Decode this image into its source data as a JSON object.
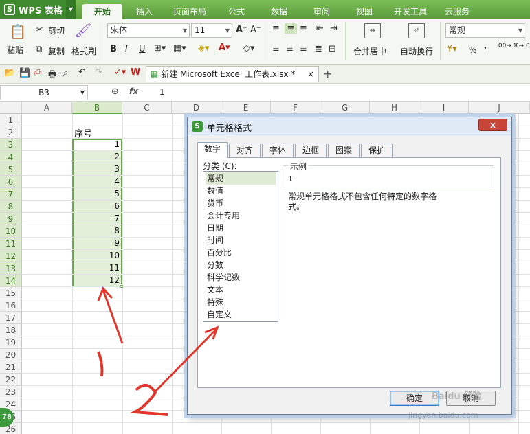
{
  "app": {
    "name": "WPS 表格",
    "logo": "S"
  },
  "tabs": [
    "开始",
    "插入",
    "页面布局",
    "公式",
    "数据",
    "审阅",
    "视图",
    "开发工具",
    "云服务"
  ],
  "active_tab": "开始",
  "ribbon": {
    "paste": "粘贴",
    "cut": "剪切",
    "copy": "复制",
    "format_painter": "格式刷",
    "font_name": "宋体",
    "font_size": "11",
    "bold": "B",
    "italic": "I",
    "underline": "U",
    "merge_center": "合并居中",
    "wrap_text": "自动换行",
    "number_format": "常规",
    "percent": "%",
    "thousands": "000",
    "comma": "❜",
    "inc_decimal": ".00→.0",
    "dec_decimal": ".0→.00"
  },
  "quick_access": {
    "doc_tab": "新建 Microsoft Excel 工作表.xlsx *",
    "close": "×",
    "new_tab": "+"
  },
  "formula_bar": {
    "name_box": "B3",
    "fx": "fx",
    "content": "1"
  },
  "columns": [
    "A",
    "B",
    "C",
    "D",
    "E",
    "F",
    "G",
    "H",
    "I",
    "J"
  ],
  "rows": [
    "1",
    "2",
    "3",
    "4",
    "5",
    "6",
    "7",
    "8",
    "9",
    "10",
    "11",
    "12",
    "13",
    "14",
    "15",
    "16",
    "17",
    "18",
    "19",
    "20",
    "21",
    "22",
    "23",
    "24",
    "25",
    "26"
  ],
  "cells": {
    "b2": "序号",
    "b_values": [
      "1",
      "2",
      "3",
      "4",
      "5",
      "6",
      "7",
      "8",
      "9",
      "10",
      "11",
      "12"
    ]
  },
  "dialog": {
    "title": "单元格格式",
    "close": "x",
    "tabs": [
      "数字",
      "对齐",
      "字体",
      "边框",
      "图案",
      "保护"
    ],
    "category_label": "分类 (C):",
    "categories": [
      "常规",
      "数值",
      "货币",
      "会计专用",
      "日期",
      "时间",
      "百分比",
      "分数",
      "科学记数",
      "文本",
      "特殊",
      "自定义"
    ],
    "selected_category": "常规",
    "sample_legend": "示例",
    "sample_value": "1",
    "description": "常规单元格格式不包含任何特定的数字格式。",
    "ok": "确定",
    "cancel": "取消"
  },
  "annotations": {
    "one": "1",
    "two": "2"
  },
  "watermark": {
    "brand": "Baidu 经验",
    "url": "jingyan.baidu.com"
  },
  "badge": "78",
  "colors": {
    "accent": "#6aa84f",
    "selection_fill": "#e4efda",
    "annotation": "#e0362c"
  }
}
